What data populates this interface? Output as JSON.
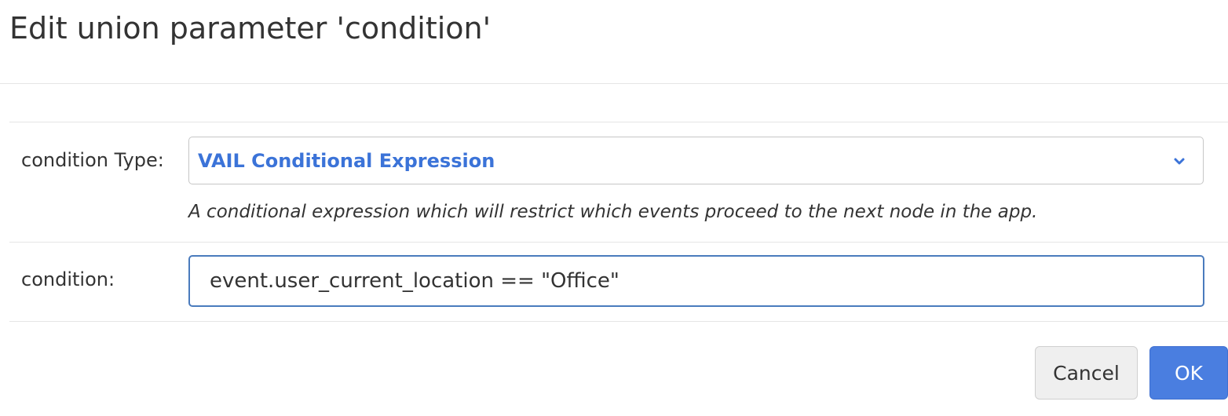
{
  "dialog": {
    "title": "Edit union parameter 'condition'"
  },
  "condition_type": {
    "label": "condition Type:",
    "selected_value": "VAIL Conditional Expression",
    "help_text": "A conditional expression which will restrict which events proceed to the next node in the app."
  },
  "condition": {
    "label": "condition:",
    "value": "event.user_current_location == \"Office\""
  },
  "buttons": {
    "cancel_label": "Cancel",
    "ok_label": "OK"
  },
  "icons": {
    "select_arrow": "chevron-down-icon"
  },
  "colors": {
    "accent": "#3b73d8",
    "primary_button": "#4a7ee0",
    "focus_border": "#4a7bbd"
  }
}
